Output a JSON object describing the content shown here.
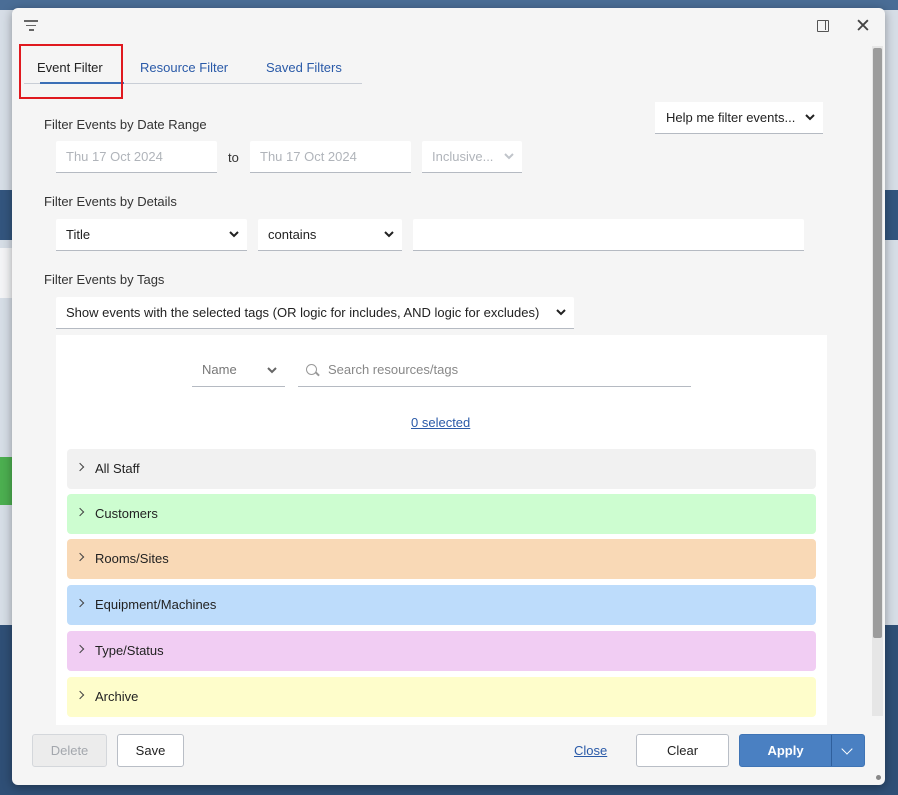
{
  "dialog": {
    "tabs": [
      {
        "label": "Event Filter",
        "active": true
      },
      {
        "label": "Resource Filter",
        "active": false
      },
      {
        "label": "Saved Filters",
        "active": false
      }
    ],
    "help_select": "Help me filter events...",
    "date_range": {
      "label": "Filter Events by Date Range",
      "from": "Thu 17 Oct 2024",
      "to_label": "to",
      "to": "Thu 17 Oct 2024",
      "mode": "Inclusive..."
    },
    "details": {
      "label": "Filter Events by Details",
      "field": "Title",
      "operator": "contains",
      "value": ""
    },
    "tags": {
      "label": "Filter Events by Tags",
      "mode": "Show events with the selected tags (OR logic for includes, AND logic for excludes)",
      "sort_select": "Name",
      "search_placeholder": "Search resources/tags",
      "selected_link": "0 selected",
      "groups": [
        {
          "label": "All Staff",
          "color": "#f1f1f1"
        },
        {
          "label": "Customers",
          "color": "#cdfdd0"
        },
        {
          "label": "Rooms/Sites",
          "color": "#f9d9b6"
        },
        {
          "label": "Equipment/Machines",
          "color": "#bddcfb"
        },
        {
          "label": "Type/Status",
          "color": "#f1cdf3"
        },
        {
          "label": "Archive",
          "color": "#fefdcb"
        }
      ]
    },
    "footer": {
      "delete": "Delete",
      "save": "Save",
      "close": "Close",
      "clear": "Clear",
      "apply": "Apply"
    }
  },
  "icons": [
    "filter-icon",
    "panel-toggle-icon",
    "close-icon",
    "search-icon",
    "chevron-right-icon",
    "chevron-down-icon"
  ]
}
